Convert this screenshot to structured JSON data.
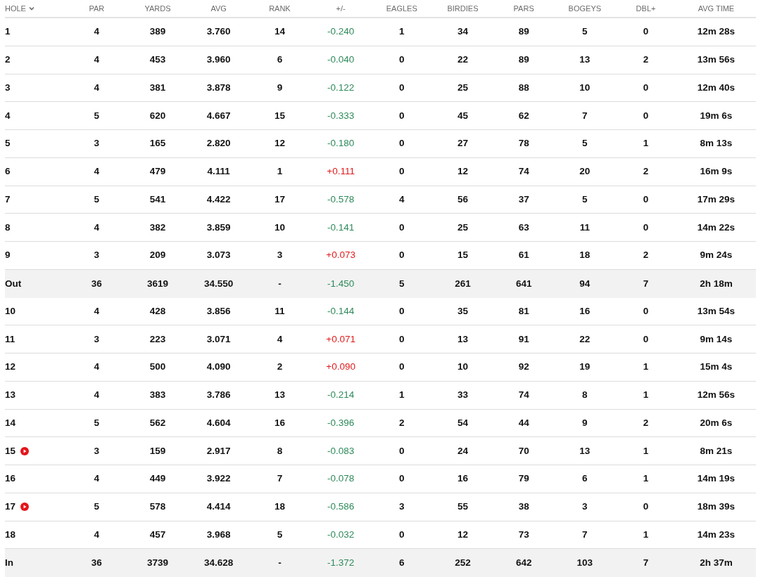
{
  "columns": [
    {
      "label": "HOLE",
      "sorted": true
    },
    {
      "label": "PAR",
      "sorted": false
    },
    {
      "label": "YARDS",
      "sorted": false
    },
    {
      "label": "AVG",
      "sorted": false
    },
    {
      "label": "RANK",
      "sorted": false
    },
    {
      "label": "+/-",
      "sorted": false
    },
    {
      "label": "EAGLES",
      "sorted": false
    },
    {
      "label": "BIRDIES",
      "sorted": false
    },
    {
      "label": "PARS",
      "sorted": false
    },
    {
      "label": "BOGEYS",
      "sorted": false
    },
    {
      "label": "DBL+",
      "sorted": false
    },
    {
      "label": "AVG TIME",
      "sorted": false
    }
  ],
  "rows": [
    {
      "kind": "hole",
      "color": "#2e8a5a",
      "cells": [
        "1",
        "4",
        "389",
        "3.760",
        "14",
        "-0.240",
        "1",
        "34",
        "89",
        "5",
        "0",
        "12m 28s"
      ]
    },
    {
      "kind": "hole",
      "color": "#2e8a5a",
      "cells": [
        "2",
        "4",
        "453",
        "3.960",
        "6",
        "-0.040",
        "0",
        "22",
        "89",
        "13",
        "2",
        "13m 56s"
      ]
    },
    {
      "kind": "hole",
      "color": "#2e8a5a",
      "cells": [
        "3",
        "4",
        "381",
        "3.878",
        "9",
        "-0.122",
        "0",
        "25",
        "88",
        "10",
        "0",
        "12m 40s"
      ]
    },
    {
      "kind": "hole",
      "color": "#2e8a5a",
      "cells": [
        "4",
        "5",
        "620",
        "4.667",
        "15",
        "-0.333",
        "0",
        "45",
        "62",
        "7",
        "0",
        "19m 6s"
      ]
    },
    {
      "kind": "hole",
      "color": "#2e8a5a",
      "cells": [
        "5",
        "3",
        "165",
        "2.820",
        "12",
        "-0.180",
        "0",
        "27",
        "78",
        "5",
        "1",
        "8m 13s"
      ]
    },
    {
      "kind": "hole",
      "color": "#e0191b",
      "cells": [
        "6",
        "4",
        "479",
        "4.111",
        "1",
        "+0.111",
        "0",
        "12",
        "74",
        "20",
        "2",
        "16m 9s"
      ]
    },
    {
      "kind": "hole",
      "color": "#2e8a5a",
      "cells": [
        "7",
        "5",
        "541",
        "4.422",
        "17",
        "-0.578",
        "4",
        "56",
        "37",
        "5",
        "0",
        "17m 29s"
      ]
    },
    {
      "kind": "hole",
      "color": "#2e8a5a",
      "cells": [
        "8",
        "4",
        "382",
        "3.859",
        "10",
        "-0.141",
        "0",
        "25",
        "63",
        "11",
        "0",
        "14m 22s"
      ]
    },
    {
      "kind": "hole",
      "color": "#e0191b",
      "cells": [
        "9",
        "3",
        "209",
        "3.073",
        "3",
        "+0.073",
        "0",
        "15",
        "61",
        "18",
        "2",
        "9m 24s"
      ]
    },
    {
      "kind": "total",
      "color": "#2e8a5a",
      "cells": [
        "Out",
        "36",
        "3619",
        "34.550",
        "-",
        "-1.450",
        "5",
        "261",
        "641",
        "94",
        "7",
        "2h 18m"
      ]
    },
    {
      "kind": "hole",
      "color": "#2e8a5a",
      "cells": [
        "10",
        "4",
        "428",
        "3.856",
        "11",
        "-0.144",
        "0",
        "35",
        "81",
        "16",
        "0",
        "13m 54s"
      ]
    },
    {
      "kind": "hole",
      "color": "#e0191b",
      "cells": [
        "11",
        "3",
        "223",
        "3.071",
        "4",
        "+0.071",
        "0",
        "13",
        "91",
        "22",
        "0",
        "9m 14s"
      ]
    },
    {
      "kind": "hole",
      "color": "#e0191b",
      "cells": [
        "12",
        "4",
        "500",
        "4.090",
        "2",
        "+0.090",
        "0",
        "10",
        "92",
        "19",
        "1",
        "15m 4s"
      ]
    },
    {
      "kind": "hole",
      "color": "#2e8a5a",
      "cells": [
        "13",
        "4",
        "383",
        "3.786",
        "13",
        "-0.214",
        "1",
        "33",
        "74",
        "8",
        "1",
        "12m 56s"
      ]
    },
    {
      "kind": "hole",
      "color": "#2e8a5a",
      "cells": [
        "14",
        "5",
        "562",
        "4.604",
        "16",
        "-0.396",
        "2",
        "54",
        "44",
        "9",
        "2",
        "20m 6s"
      ]
    },
    {
      "kind": "hole",
      "video": true,
      "color": "#2e8a5a",
      "cells": [
        "15",
        "3",
        "159",
        "2.917",
        "8",
        "-0.083",
        "0",
        "24",
        "70",
        "13",
        "1",
        "8m 21s"
      ]
    },
    {
      "kind": "hole",
      "color": "#2e8a5a",
      "cells": [
        "16",
        "4",
        "449",
        "3.922",
        "7",
        "-0.078",
        "0",
        "16",
        "79",
        "6",
        "1",
        "14m 19s"
      ]
    },
    {
      "kind": "hole",
      "video": true,
      "color": "#2e8a5a",
      "cells": [
        "17",
        "5",
        "578",
        "4.414",
        "18",
        "-0.586",
        "3",
        "55",
        "38",
        "3",
        "0",
        "18m 39s"
      ]
    },
    {
      "kind": "hole",
      "color": "#2e8a5a",
      "cells": [
        "18",
        "4",
        "457",
        "3.968",
        "5",
        "-0.032",
        "0",
        "12",
        "73",
        "7",
        "1",
        "14m 23s"
      ]
    },
    {
      "kind": "total",
      "color": "#2e8a5a",
      "cells": [
        "In",
        "36",
        "3739",
        "34.628",
        "-",
        "-1.372",
        "6",
        "252",
        "642",
        "103",
        "7",
        "2h 37m"
      ]
    }
  ]
}
